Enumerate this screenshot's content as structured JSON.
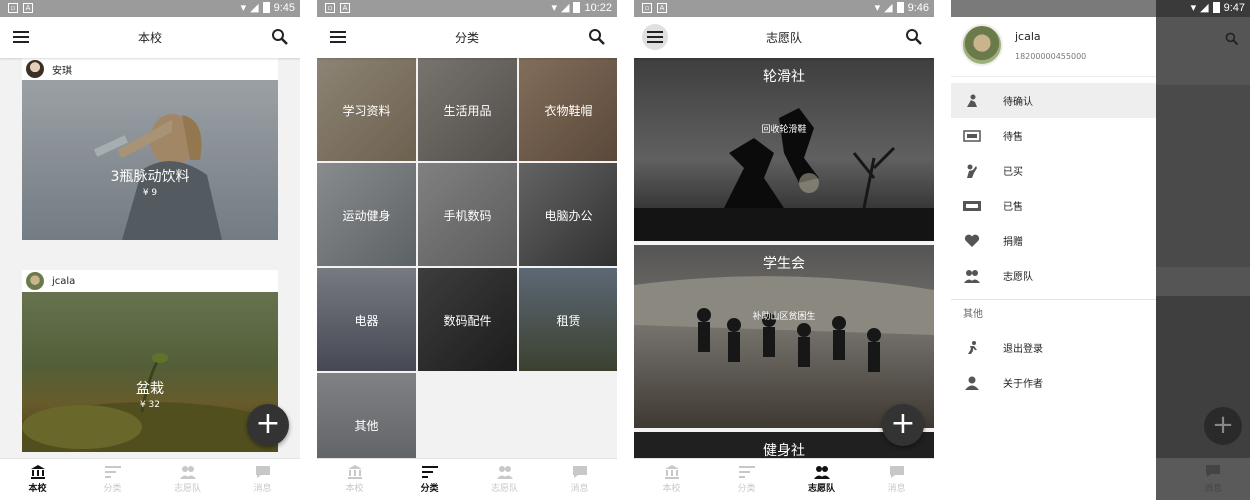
{
  "status": {
    "p1_time": "9:45",
    "p2_time": "10:22",
    "p3_time": "9:46",
    "p4_time": "9:47"
  },
  "titles": {
    "p1": "本校",
    "p2": "分类",
    "p3": "志愿队"
  },
  "nav": {
    "school": "本校",
    "category": "分类",
    "volunteer": "志愿队",
    "messages": "消息"
  },
  "fab_symbol": "+",
  "feed": [
    {
      "user": "安琪",
      "name": "3瓶脉动饮料",
      "price": "¥ 9"
    },
    {
      "user": "jcala",
      "name": "盆栽",
      "price": "¥ 32"
    }
  ],
  "categories": [
    "学习资料",
    "生活用品",
    "衣物鞋帽",
    "运动健身",
    "手机数码",
    "电脑办公",
    "电器",
    "数码配件",
    "租赁",
    "其他"
  ],
  "volunteer_teams": [
    {
      "title": "轮滑社",
      "subtitle": "回收轮滑鞋"
    },
    {
      "title": "学生会",
      "subtitle": "补助山区贫困生"
    },
    {
      "title": "健身社",
      "subtitle": ""
    }
  ],
  "drawer": {
    "name": "jcala",
    "phone": "18200000455000",
    "items": [
      {
        "label": "待确认",
        "icon": "pending-icon"
      },
      {
        "label": "待售",
        "icon": "for-sale-icon"
      },
      {
        "label": "已买",
        "icon": "bought-icon"
      },
      {
        "label": "已售",
        "icon": "sold-icon"
      },
      {
        "label": "捐赠",
        "icon": "heart-icon"
      },
      {
        "label": "志愿队",
        "icon": "group-icon"
      }
    ],
    "other_header": "其他",
    "other_items": [
      {
        "label": "退出登录",
        "icon": "logout-icon"
      },
      {
        "label": "关于作者",
        "icon": "person-icon"
      }
    ]
  },
  "colors": {
    "fab": "#333333",
    "active_nav": "#111111",
    "inactive_nav": "#c8c8c8",
    "statusbar": "#9b9b9b"
  }
}
